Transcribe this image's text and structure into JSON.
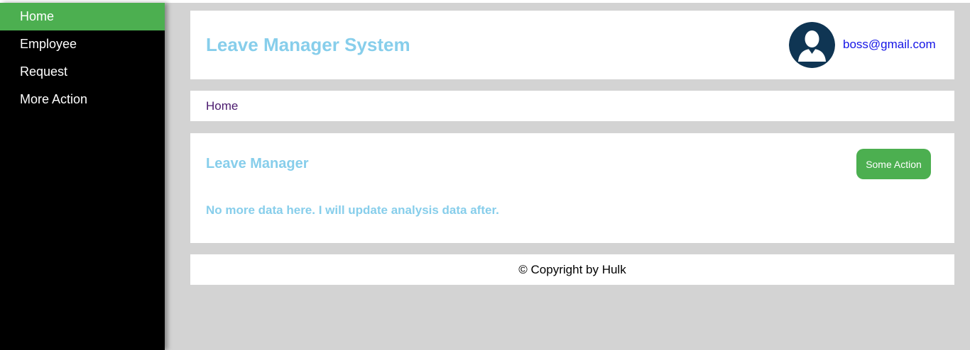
{
  "sidebar": {
    "items": [
      {
        "label": "Home",
        "active": true
      },
      {
        "label": "Employee",
        "active": false
      },
      {
        "label": "Request",
        "active": false
      },
      {
        "label": "More Action",
        "active": false
      }
    ]
  },
  "header": {
    "title": "Leave Manager System",
    "user_email": "boss@gmail.com",
    "avatar_icon": "user-avatar-icon"
  },
  "breadcrumb": {
    "current": "Home"
  },
  "main": {
    "title": "Leave Manager",
    "action_label": "Some Action",
    "message": "No more data here. I will update analysis data after."
  },
  "footer": {
    "text": "© Copyright by Hulk"
  },
  "colors": {
    "accent_green": "#4caf50",
    "title_blue": "#87ceeb",
    "sidebar_bg": "#000000",
    "page_bg": "#d3d3d3",
    "link_blue": "#1414e6",
    "avatar_navy": "#0f3553"
  }
}
